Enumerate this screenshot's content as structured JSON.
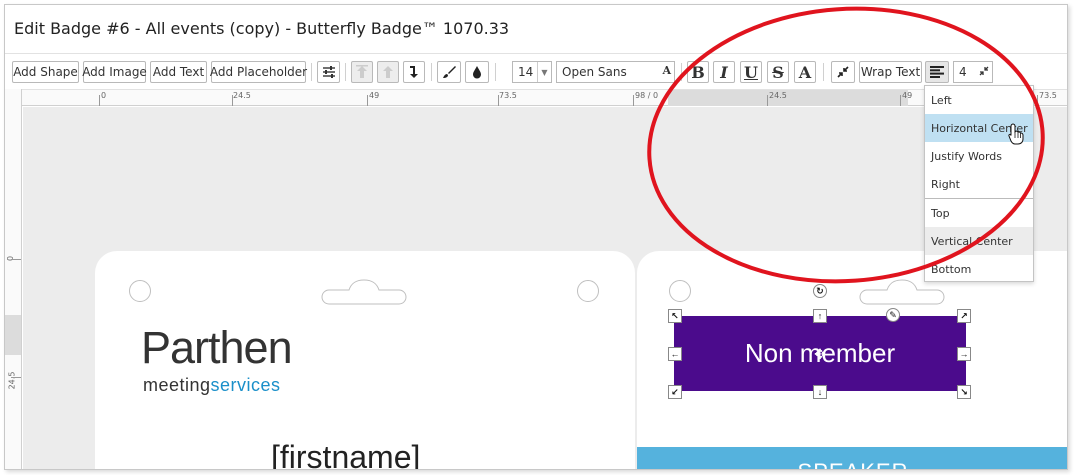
{
  "window": {
    "title": "Edit Badge #6 - All events (copy) - Butterfly Badge™ 1070.33"
  },
  "toolbar": {
    "add_shape": "Add Shape",
    "add_image": "Add Image",
    "add_text": "Add Text",
    "add_placeholder": "Add Placeholder",
    "settings_icon": "sliders-icon",
    "font_size": "14",
    "font_family": "Open Sans",
    "bold": "B",
    "italic": "I",
    "underline": "U",
    "strike": "S",
    "font_color": "A",
    "wrap_text": "Wrap Text",
    "line_spacing": "4"
  },
  "rulers": {
    "horizontal": [
      "0",
      "24.5",
      "49",
      "73.5",
      "98 / 0",
      "24.5",
      "49",
      "73.5"
    ],
    "vertical": [
      "0",
      "24.5"
    ]
  },
  "alignment_menu": {
    "items": [
      "Left",
      "Horizontal Center",
      "Justify Words",
      "Right",
      "Top",
      "Vertical Center",
      "Bottom"
    ],
    "hovered": "Horizontal Center",
    "selected": "Vertical Center"
  },
  "badge_left": {
    "logo_main": "Parthen",
    "logo_sub_a": "meeting",
    "logo_sub_b": "services",
    "name_placeholder": "[firstname]"
  },
  "badge_right": {
    "member_label": "Non member",
    "member_color": "#4b0b8c",
    "speaker_label": "SPEAKER",
    "speaker_color": "#55b2dd"
  },
  "annotation": {
    "color": "#e0141e"
  }
}
